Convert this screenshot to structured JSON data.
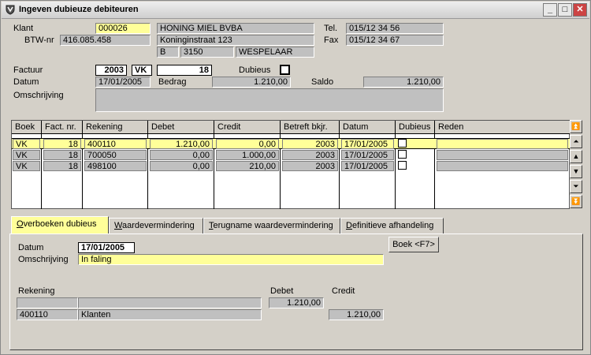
{
  "window": {
    "title": "Ingeven dubieuze debiteuren",
    "minimize": "_",
    "maximize": "□",
    "close": "✕"
  },
  "header": {
    "klant_label": "Klant",
    "klant_value": "000026",
    "klant_name": "HONING MIEL BVBA",
    "tel_label": "Tel.",
    "tel_value": "015/12 34 56",
    "btw_label": "BTW-nr",
    "btw_value": "416.085.458",
    "street": "Koninginstraat 123",
    "fax_label": "Fax",
    "fax_value": "015/12 34 67",
    "country": "B",
    "postcode": "3150",
    "city": "WESPELAAR"
  },
  "invoice": {
    "factuur_label": "Factuur",
    "year": "2003",
    "journal": "VK",
    "number": "18",
    "dubieus_label": "Dubieus",
    "datum_label": "Datum",
    "datum_value": "17/01/2005",
    "bedrag_label": "Bedrag",
    "bedrag_value": "1.210,00",
    "saldo_label": "Saldo",
    "saldo_value": "1.210,00",
    "omschrijving_label": "Omschrijving",
    "omschrijving_value": ""
  },
  "grid": {
    "columns": [
      "Boek",
      "Fact. nr.",
      "Rekening",
      "Debet",
      "Credit",
      "Betreft bkjr.",
      "Datum",
      "Dubieus",
      "Reden"
    ],
    "rows": [
      {
        "boek": "VK",
        "fact": "18",
        "rek": "400110",
        "debet": "1.210,00",
        "credit": "0,00",
        "bkjr": "2003",
        "datum": "17/01/2005",
        "reden": ""
      },
      {
        "boek": "VK",
        "fact": "18",
        "rek": "700050",
        "debet": "0,00",
        "credit": "1.000,00",
        "bkjr": "2003",
        "datum": "17/01/2005",
        "reden": ""
      },
      {
        "boek": "VK",
        "fact": "18",
        "rek": "498100",
        "debet": "0,00",
        "credit": "210,00",
        "bkjr": "2003",
        "datum": "17/01/2005",
        "reden": ""
      }
    ]
  },
  "tabs": [
    "Overboeken dubieus",
    "Waardevermindering",
    "Terugname waardevermindering",
    "Definitieve afhandeling"
  ],
  "panel": {
    "datum_label": "Datum",
    "datum_value": "17/01/2005",
    "omschrijving_label": "Omschrijving",
    "omschrijving_value": "In faling",
    "boek_button": "Boek <F7>",
    "rekening_label": "Rekening",
    "debet_label": "Debet",
    "credit_label": "Credit",
    "line1_debet": "1.210,00",
    "line2_account": "400110",
    "line2_name": "Klanten",
    "line2_credit": "1.210,00"
  }
}
